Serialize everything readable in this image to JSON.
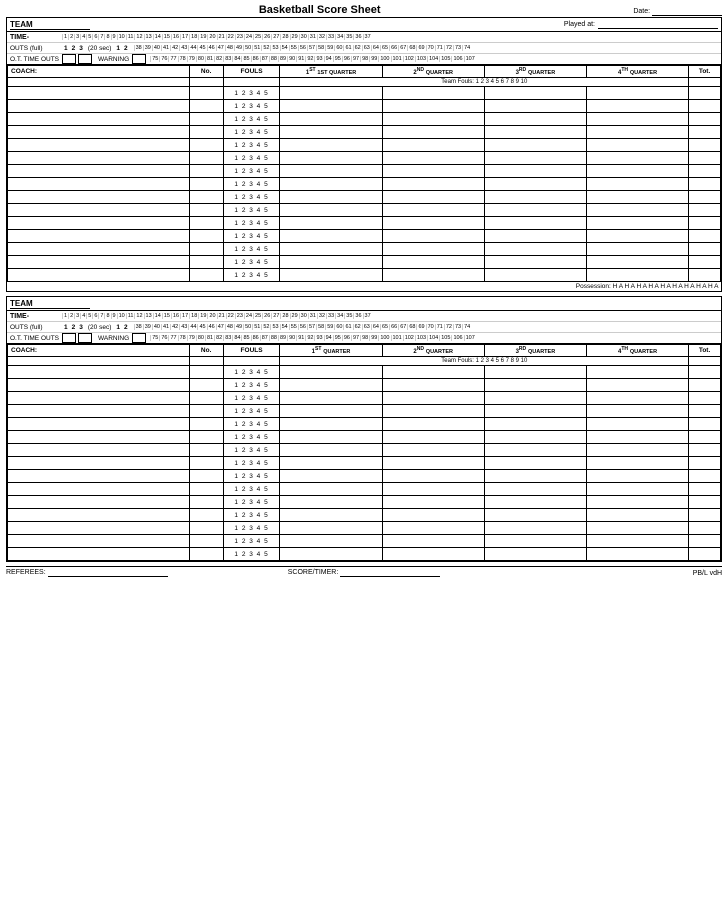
{
  "header": {
    "title": "Basketball Score Sheet",
    "date_label": "Date:",
    "date_value": ""
  },
  "team1": {
    "team_label": "TEAM",
    "played_at_label": "Played at:",
    "time_label": "TIME-",
    "time_numbers_row1": [
      1,
      2,
      3,
      4,
      5,
      6,
      7,
      8,
      9,
      10,
      11,
      12,
      13,
      14,
      15,
      16,
      17,
      18,
      19,
      20,
      21,
      22,
      23,
      24,
      25,
      26,
      27,
      28,
      29,
      30,
      31,
      32,
      33,
      34,
      35,
      36,
      37
    ],
    "time_numbers_row2": [
      38,
      39,
      40,
      41,
      42,
      43,
      44,
      45,
      46,
      47,
      48,
      49,
      50,
      51,
      52,
      53,
      54,
      55,
      56,
      57,
      58,
      59,
      60,
      61,
      62,
      63,
      64,
      65,
      66,
      67,
      68,
      69,
      70,
      71,
      72,
      73,
      74
    ],
    "time_numbers_row3": [
      75,
      76,
      77,
      78,
      79,
      80,
      81,
      82,
      83,
      84,
      85,
      86,
      87,
      88,
      89,
      90,
      91,
      92,
      93,
      94,
      95,
      96,
      97,
      98,
      99,
      100,
      101,
      102,
      103,
      104,
      105,
      106,
      107
    ],
    "outs_label": "OUTS (full)",
    "outs_numbers": [
      1,
      2,
      3
    ],
    "outs_sec": "(20 sec)",
    "outs_extra": [
      1,
      2
    ],
    "ot_label": "O.T. TIME OUTS",
    "warning_label": "WARNING",
    "coach_label": "COACH:",
    "no_label": "No.",
    "fouls_label": "FOULS",
    "q1_label": "1ST QUARTER",
    "q2_label": "2ND QUARTER",
    "q3_label": "3RD QUARTER",
    "q4_label": "4TH QUARTER",
    "tot_label": "Tot.",
    "team_fouls_label": "Team Fouls: 1 2 3 4 5 6 7 8 9 10",
    "fouls_numbers": "1 2 3 4 5",
    "num_rows": 15,
    "possession_label": "Possession: H  A  H  A  H  A  H  A  H  A  H  A  H  A  H  A  H  A"
  },
  "team2": {
    "team_label": "TEAM",
    "time_label": "TIME-",
    "outs_label": "OUTS (full)",
    "outs_numbers": [
      1,
      2,
      3
    ],
    "outs_sec": "(20 sec)",
    "outs_extra": [
      1,
      2
    ],
    "ot_label": "O.T. TIME OUTS",
    "warning_label": "WARNING",
    "coach_label": "COACH:",
    "no_label": "No.",
    "fouls_label": "FOULS",
    "q1_label": "1ST QUARTER",
    "q2_label": "2ND QUARTER",
    "q3_label": "3RD QUARTER",
    "q4_label": "4TH QUARTER",
    "tot_label": "Tot.",
    "team_fouls_label": "Team Fouls: 1 2 3 4 5 6 7 8 9 10",
    "fouls_numbers": "1 2 3 4 5",
    "num_rows": 15
  },
  "footer": {
    "referees_label": "REFEREES:",
    "score_timer_label": "SCORE/TIMER:",
    "pb_label": "PB/L vdH"
  }
}
